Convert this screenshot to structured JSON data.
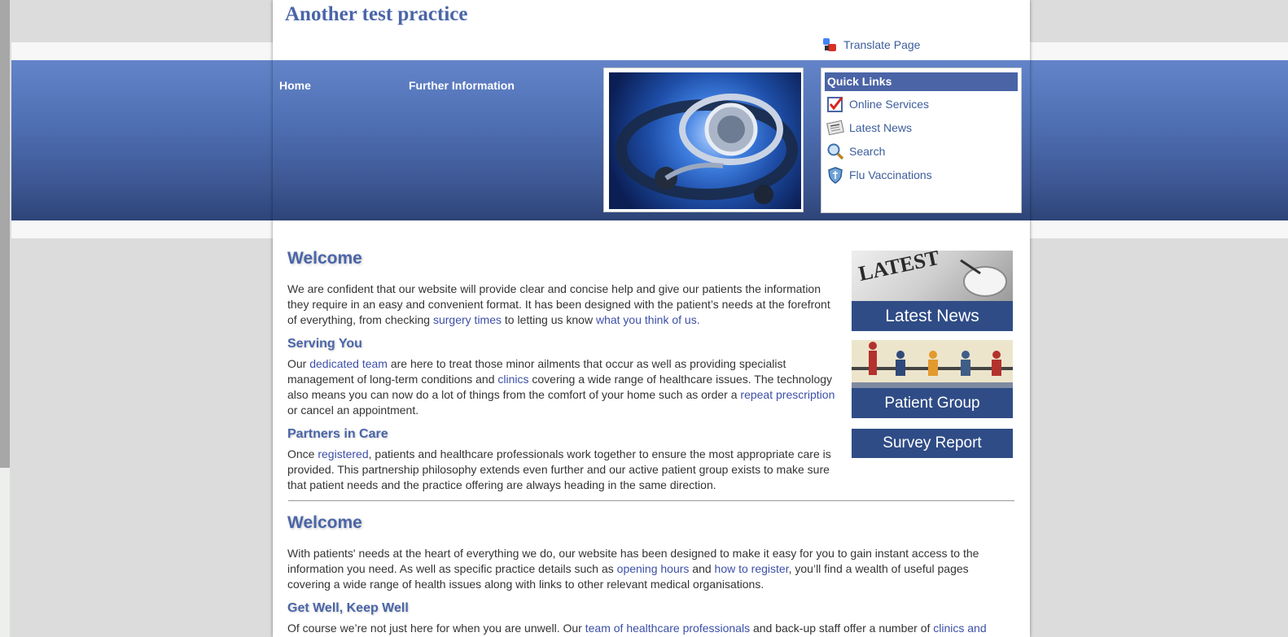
{
  "site": {
    "title": "Another test practice",
    "translate_label": "Translate Page"
  },
  "nav": {
    "items": [
      {
        "label": "Home"
      },
      {
        "label": "Further Information"
      }
    ]
  },
  "quick_links": {
    "heading": "Quick Links",
    "items": [
      {
        "label": "Online Services",
        "icon": "checklist-icon"
      },
      {
        "label": "Latest News",
        "icon": "newspaper-icon"
      },
      {
        "label": "Search",
        "icon": "magnifier-icon"
      },
      {
        "label": "Flu Vaccinations",
        "icon": "shield-icon"
      }
    ]
  },
  "content": {
    "welcome1": {
      "heading": "Welcome",
      "p1_a": "We are confident that our website will provide clear and concise help and give our patients the information they require in an easy and convenient format. It has been designed with the patient’s needs at the forefront of everything, from checking ",
      "p1_link1": "surgery times",
      "p1_b": " to letting us know ",
      "p1_link2": "what you think of us."
    },
    "serving": {
      "heading": "Serving You",
      "a": "Our ",
      "link1": "dedicated team",
      "b": " are here to treat those minor ailments that occur as well as providing specialist management of long-term conditions and ",
      "link2": "clinics",
      "c": " covering a wide range of healthcare issues. The technology also means you can now do a lot of things from the comfort of your home such as order a ",
      "link3": "repeat prescription",
      "d": " or cancel an appointment."
    },
    "partners": {
      "heading": "Partners in Care",
      "a": "Once ",
      "link1": "registered",
      "b": ", patients and healthcare professionals work together to ensure the most appropriate care is provided. This partnership philosophy extends even further and our active patient group exists to make sure that patient needs and the practice offering are always heading in the same direction."
    },
    "welcome2": {
      "heading": "Welcome",
      "a": "With patients' needs at the heart of everything we do, our website has been designed to make it easy for you to gain instant access to the information you need. As well as specific practice details such as ",
      "link1": "opening hours",
      "b": " and ",
      "link2": "how to register",
      "c": ", you’ll find a wealth of useful pages covering a wide range of health issues along with links to other relevant medical organisations."
    },
    "getwell": {
      "heading": "Get Well, Keep Well",
      "a": "Of course we’re not just here for when you are unwell. Our ",
      "link1": "team of healthcare professionals",
      "b": " and back-up staff offer a number of ",
      "link2": "clinics and"
    }
  },
  "promos": {
    "latest_news": {
      "label": "Latest News",
      "banner_text": "LATEST"
    },
    "patient_group": {
      "label": "Patient Group"
    },
    "survey_report": {
      "label": "Survey Report"
    }
  },
  "colors": {
    "brand": "#4a65a8",
    "link": "#3c4fa8",
    "header_blue": "#4f6fb3",
    "promo_blue": "#2f4c86"
  }
}
